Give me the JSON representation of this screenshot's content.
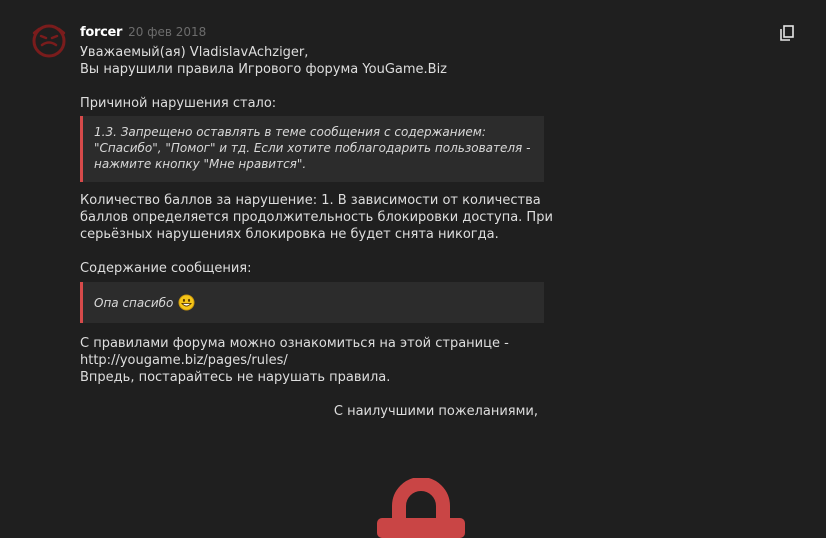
{
  "post": {
    "author": "forcer",
    "date": "20 фев 2018",
    "greeting_lines": [
      "Уважаемый(ая) VladislavAchziger,",
      "Вы нарушили правила Игрового форума YouGame.Biz"
    ],
    "reason_label": "Причиной нарушения стало:",
    "rule_quote_lines": [
      "1.3. Запрещено оставлять в теме сообщения с содержанием:",
      "\"Спасибо\", \"Помог\" и тд. Если хотите поблагодарить пользователя -",
      "нажмите кнопку \"Мне нравится\"."
    ],
    "points_lines": [
      "Количество баллов за нарушение: 1. В зависимости от количества",
      "баллов определяется продолжительность блокировки доступа. При",
      "серьёзных нарушениях блокировка не будет снята никогда."
    ],
    "content_label": "Содержание сообщения:",
    "message_quote": "Опа спасибо",
    "rules_link_lines": [
      "С правилами форума можно ознакомиться на этой странице -",
      "http://yougame.biz/pages/rules/",
      "Впредь, постарайтесь не нарушать правила."
    ],
    "signature": "С наилучшими пожеланиями,"
  },
  "icons": {
    "avatar": "avatar-icon",
    "copy": "copy-icon",
    "smiley": "grinning-smiley-icon",
    "lock": "lock-icon"
  },
  "colors": {
    "background": "#1f1f1f",
    "quote_background": "#2c2c2c",
    "quote_border": "#d64a4a",
    "avatar": "#8b1f1f",
    "lock": "#c94545"
  }
}
